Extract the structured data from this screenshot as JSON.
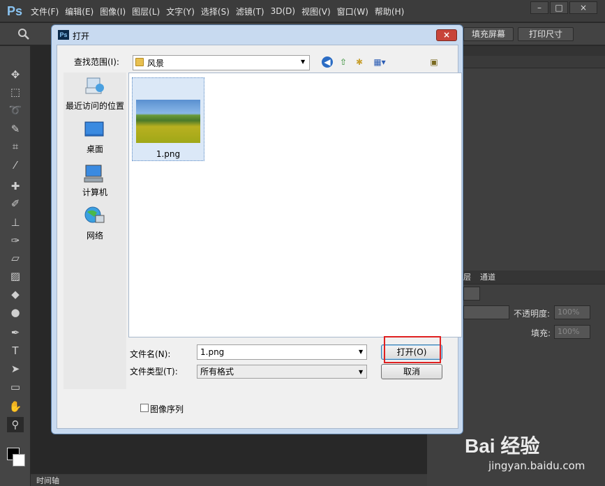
{
  "app": {
    "logo": "Ps",
    "menu": [
      "文件(F)",
      "编辑(E)",
      "图像(I)",
      "图层(L)",
      "文字(Y)",
      "选择(S)",
      "滤镜(T)",
      "3D(D)",
      "视图(V)",
      "窗口(W)",
      "帮助(H)"
    ],
    "window_buttons": [
      "–",
      "□",
      "×"
    ]
  },
  "options_bar": {
    "fill_screen": "填充屏幕",
    "print_size": "打印尺寸"
  },
  "toolbar": {
    "tools": [
      "move",
      "marquee",
      "lasso",
      "quick-select",
      "crop",
      "eyedropper",
      "healing",
      "brush",
      "stamp",
      "history-brush",
      "eraser",
      "gradient",
      "blur",
      "dodge",
      "pen",
      "type",
      "path-select",
      "shape",
      "hand",
      "zoom"
    ],
    "type_glyph": "T"
  },
  "layers_panel": {
    "tab_layers": "层",
    "tab_channels": "通道",
    "opacity_label": "不透明度:",
    "opacity_value": "100%",
    "fill_label": "填充:",
    "fill_value": "100%"
  },
  "timeline": {
    "label": "时间轴"
  },
  "dialog": {
    "title": "打开",
    "title_icon": "Ps",
    "close": "×",
    "look_in_label": "查找范围(I):",
    "look_in_value": "风景",
    "places": [
      {
        "label": "最近访问的位置",
        "icon": "recent-places-icon"
      },
      {
        "label": "桌面",
        "icon": "desktop-icon"
      },
      {
        "label": "计算机",
        "icon": "computer-icon"
      },
      {
        "label": "网络",
        "icon": "network-icon"
      }
    ],
    "files": [
      {
        "name": "1.png"
      }
    ],
    "file_name_label": "文件名(N):",
    "file_name_value": "1.png",
    "file_type_label": "文件类型(T):",
    "file_type_value": "所有格式",
    "open_button": "打开(O)",
    "cancel_button": "取消",
    "image_sequence": "图像序列"
  },
  "watermark": {
    "brand": "Bai 经验",
    "url": "jingyan.baidu.com"
  }
}
